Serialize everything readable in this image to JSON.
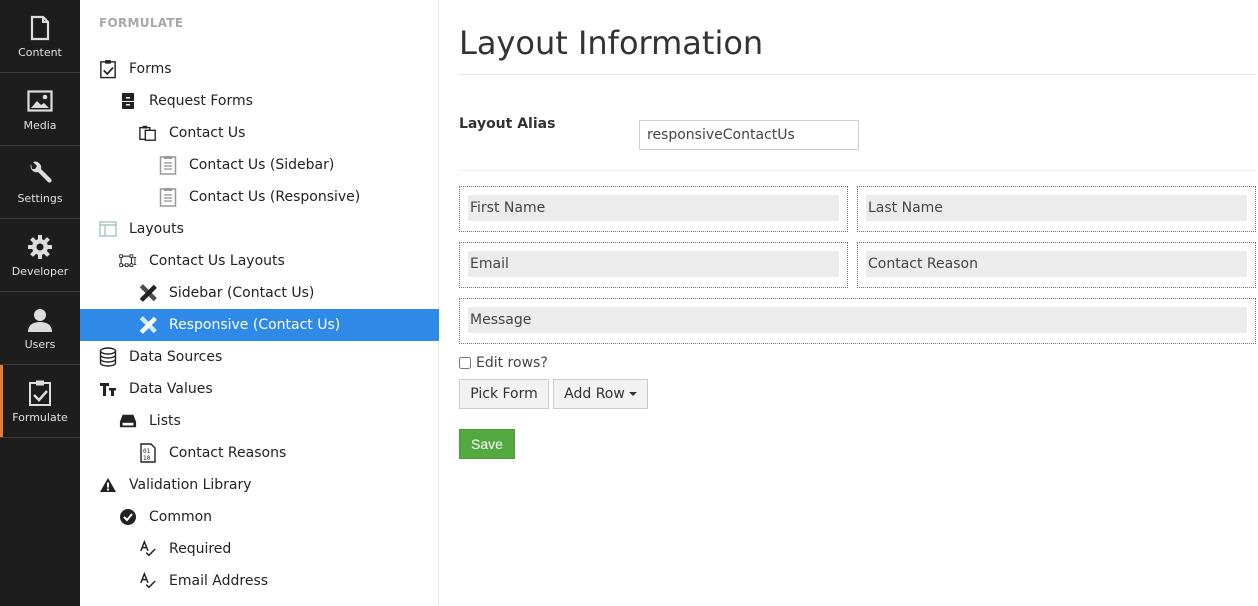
{
  "sections": [
    {
      "label": "Content",
      "icon": "document-icon"
    },
    {
      "label": "Media",
      "icon": "image-icon"
    },
    {
      "label": "Settings",
      "icon": "wrench-icon"
    },
    {
      "label": "Developer",
      "icon": "gear-icon"
    },
    {
      "label": "Users",
      "icon": "user-icon"
    },
    {
      "label": "Formulate",
      "icon": "clipboard-check-icon",
      "active": true
    }
  ],
  "tree": {
    "header": "FORMULATE",
    "nodes": [
      {
        "label": "Forms",
        "icon": "clipboard-check-icon",
        "level": 0
      },
      {
        "label": "Request Forms",
        "icon": "file-cabinet-icon",
        "level": 1
      },
      {
        "label": "Contact Us",
        "icon": "clipboard-stack-icon",
        "level": 2
      },
      {
        "label": "Contact Us (Sidebar)",
        "icon": "form-document-icon",
        "level": 3
      },
      {
        "label": "Contact Us (Responsive)",
        "icon": "form-document-icon",
        "level": 3
      },
      {
        "label": "Layouts",
        "icon": "layout-icon",
        "level": 0
      },
      {
        "label": "Contact Us Layouts",
        "icon": "layout-group-icon",
        "level": 1
      },
      {
        "label": "Sidebar (Contact Us)",
        "icon": "pencil-ruler-icon",
        "level": 2
      },
      {
        "label": "Responsive (Contact Us)",
        "icon": "pencil-ruler-icon",
        "level": 2,
        "active": true
      },
      {
        "label": "Data Sources",
        "icon": "database-icon",
        "level": 0
      },
      {
        "label": "Data Values",
        "icon": "text-size-icon",
        "level": 0
      },
      {
        "label": "Lists",
        "icon": "tray-icon",
        "level": 1
      },
      {
        "label": "Contact Reasons",
        "icon": "binary-file-icon",
        "level": 2
      },
      {
        "label": "Validation Library",
        "icon": "warning-icon",
        "level": 0
      },
      {
        "label": "Common",
        "icon": "check-circle-icon",
        "level": 1
      },
      {
        "label": "Required",
        "icon": "spellcheck-icon",
        "level": 2
      },
      {
        "label": "Email Address",
        "icon": "spellcheck-icon",
        "level": 2
      }
    ]
  },
  "main": {
    "title": "Layout Information",
    "alias_label": "Layout Alias",
    "alias_value": "responsiveContactUs",
    "rows": [
      [
        "First Name",
        "Last Name"
      ],
      [
        "Email",
        "Contact Reason"
      ],
      [
        "Message"
      ]
    ],
    "edit_rows_label": "Edit rows?",
    "edit_rows_checked": false,
    "pick_form_label": "Pick Form",
    "add_row_label": "Add Row",
    "save_label": "Save"
  }
}
